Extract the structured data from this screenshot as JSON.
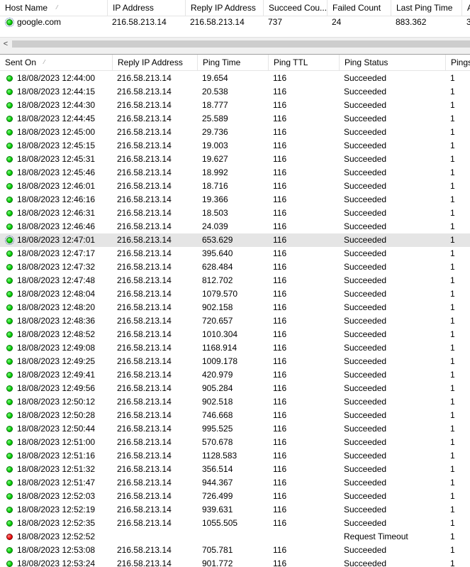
{
  "top_table": {
    "columns": [
      {
        "label": "Host Name",
        "sort_glyph": "⁄"
      },
      {
        "label": "IP Address"
      },
      {
        "label": "Reply IP Address"
      },
      {
        "label": "Succeed Cou..."
      },
      {
        "label": "Failed Count"
      },
      {
        "label": "Last Ping Time"
      },
      {
        "label": "A"
      }
    ],
    "rows": [
      {
        "status": "green",
        "cells": [
          "google.com",
          "216.58.213.14",
          "216.58.213.14",
          "737",
          "24",
          "883.362",
          "3"
        ]
      }
    ]
  },
  "scrollbar": {
    "left_arrow": "<"
  },
  "bottom_table": {
    "columns": [
      {
        "label": "Sent On",
        "sort_glyph": "⁄"
      },
      {
        "label": "Reply IP Address"
      },
      {
        "label": "Ping Time"
      },
      {
        "label": "Ping TTL"
      },
      {
        "label": "Ping Status"
      },
      {
        "label": "Pings"
      }
    ],
    "rows": [
      {
        "status": "green",
        "cells": [
          "18/08/2023 12:44:00",
          "216.58.213.14",
          "19.654",
          "116",
          "Succeeded",
          "1"
        ]
      },
      {
        "status": "green",
        "cells": [
          "18/08/2023 12:44:15",
          "216.58.213.14",
          "20.538",
          "116",
          "Succeeded",
          "1"
        ]
      },
      {
        "status": "green",
        "cells": [
          "18/08/2023 12:44:30",
          "216.58.213.14",
          "18.777",
          "116",
          "Succeeded",
          "1"
        ]
      },
      {
        "status": "green",
        "cells": [
          "18/08/2023 12:44:45",
          "216.58.213.14",
          "25.589",
          "116",
          "Succeeded",
          "1"
        ]
      },
      {
        "status": "green",
        "cells": [
          "18/08/2023 12:45:00",
          "216.58.213.14",
          "29.736",
          "116",
          "Succeeded",
          "1"
        ]
      },
      {
        "status": "green",
        "cells": [
          "18/08/2023 12:45:15",
          "216.58.213.14",
          "19.003",
          "116",
          "Succeeded",
          "1"
        ]
      },
      {
        "status": "green",
        "cells": [
          "18/08/2023 12:45:31",
          "216.58.213.14",
          "19.627",
          "116",
          "Succeeded",
          "1"
        ]
      },
      {
        "status": "green",
        "cells": [
          "18/08/2023 12:45:46",
          "216.58.213.14",
          "18.992",
          "116",
          "Succeeded",
          "1"
        ]
      },
      {
        "status": "green",
        "cells": [
          "18/08/2023 12:46:01",
          "216.58.213.14",
          "18.716",
          "116",
          "Succeeded",
          "1"
        ]
      },
      {
        "status": "green",
        "cells": [
          "18/08/2023 12:46:16",
          "216.58.213.14",
          "19.366",
          "116",
          "Succeeded",
          "1"
        ]
      },
      {
        "status": "green",
        "cells": [
          "18/08/2023 12:46:31",
          "216.58.213.14",
          "18.503",
          "116",
          "Succeeded",
          "1"
        ]
      },
      {
        "status": "green",
        "cells": [
          "18/08/2023 12:46:46",
          "216.58.213.14",
          "24.039",
          "116",
          "Succeeded",
          "1"
        ]
      },
      {
        "status": "green",
        "selected": true,
        "cells": [
          "18/08/2023 12:47:01",
          "216.58.213.14",
          "653.629",
          "116",
          "Succeeded",
          "1"
        ]
      },
      {
        "status": "green",
        "cells": [
          "18/08/2023 12:47:17",
          "216.58.213.14",
          "395.640",
          "116",
          "Succeeded",
          "1"
        ]
      },
      {
        "status": "green",
        "cells": [
          "18/08/2023 12:47:32",
          "216.58.213.14",
          "628.484",
          "116",
          "Succeeded",
          "1"
        ]
      },
      {
        "status": "green",
        "cells": [
          "18/08/2023 12:47:48",
          "216.58.213.14",
          "812.702",
          "116",
          "Succeeded",
          "1"
        ]
      },
      {
        "status": "green",
        "cells": [
          "18/08/2023 12:48:04",
          "216.58.213.14",
          "1079.570",
          "116",
          "Succeeded",
          "1"
        ]
      },
      {
        "status": "green",
        "cells": [
          "18/08/2023 12:48:20",
          "216.58.213.14",
          "902.158",
          "116",
          "Succeeded",
          "1"
        ]
      },
      {
        "status": "green",
        "cells": [
          "18/08/2023 12:48:36",
          "216.58.213.14",
          "720.657",
          "116",
          "Succeeded",
          "1"
        ]
      },
      {
        "status": "green",
        "cells": [
          "18/08/2023 12:48:52",
          "216.58.213.14",
          "1010.304",
          "116",
          "Succeeded",
          "1"
        ]
      },
      {
        "status": "green",
        "cells": [
          "18/08/2023 12:49:08",
          "216.58.213.14",
          "1168.914",
          "116",
          "Succeeded",
          "1"
        ]
      },
      {
        "status": "green",
        "cells": [
          "18/08/2023 12:49:25",
          "216.58.213.14",
          "1009.178",
          "116",
          "Succeeded",
          "1"
        ]
      },
      {
        "status": "green",
        "cells": [
          "18/08/2023 12:49:41",
          "216.58.213.14",
          "420.979",
          "116",
          "Succeeded",
          "1"
        ]
      },
      {
        "status": "green",
        "cells": [
          "18/08/2023 12:49:56",
          "216.58.213.14",
          "905.284",
          "116",
          "Succeeded",
          "1"
        ]
      },
      {
        "status": "green",
        "cells": [
          "18/08/2023 12:50:12",
          "216.58.213.14",
          "902.518",
          "116",
          "Succeeded",
          "1"
        ]
      },
      {
        "status": "green",
        "cells": [
          "18/08/2023 12:50:28",
          "216.58.213.14",
          "746.668",
          "116",
          "Succeeded",
          "1"
        ]
      },
      {
        "status": "green",
        "cells": [
          "18/08/2023 12:50:44",
          "216.58.213.14",
          "995.525",
          "116",
          "Succeeded",
          "1"
        ]
      },
      {
        "status": "green",
        "cells": [
          "18/08/2023 12:51:00",
          "216.58.213.14",
          "570.678",
          "116",
          "Succeeded",
          "1"
        ]
      },
      {
        "status": "green",
        "cells": [
          "18/08/2023 12:51:16",
          "216.58.213.14",
          "1128.583",
          "116",
          "Succeeded",
          "1"
        ]
      },
      {
        "status": "green",
        "cells": [
          "18/08/2023 12:51:32",
          "216.58.213.14",
          "356.514",
          "116",
          "Succeeded",
          "1"
        ]
      },
      {
        "status": "green",
        "cells": [
          "18/08/2023 12:51:47",
          "216.58.213.14",
          "944.367",
          "116",
          "Succeeded",
          "1"
        ]
      },
      {
        "status": "green",
        "cells": [
          "18/08/2023 12:52:03",
          "216.58.213.14",
          "726.499",
          "116",
          "Succeeded",
          "1"
        ]
      },
      {
        "status": "green",
        "cells": [
          "18/08/2023 12:52:19",
          "216.58.213.14",
          "939.631",
          "116",
          "Succeeded",
          "1"
        ]
      },
      {
        "status": "green",
        "cells": [
          "18/08/2023 12:52:35",
          "216.58.213.14",
          "1055.505",
          "116",
          "Succeeded",
          "1"
        ]
      },
      {
        "status": "red",
        "cells": [
          "18/08/2023 12:52:52",
          "",
          "",
          "",
          "Request Timeout",
          "1"
        ]
      },
      {
        "status": "green",
        "cells": [
          "18/08/2023 12:53:08",
          "216.58.213.14",
          "705.781",
          "116",
          "Succeeded",
          "1"
        ]
      },
      {
        "status": "green",
        "cells": [
          "18/08/2023 12:53:24",
          "216.58.213.14",
          "901.772",
          "116",
          "Succeeded",
          "1"
        ]
      }
    ]
  }
}
